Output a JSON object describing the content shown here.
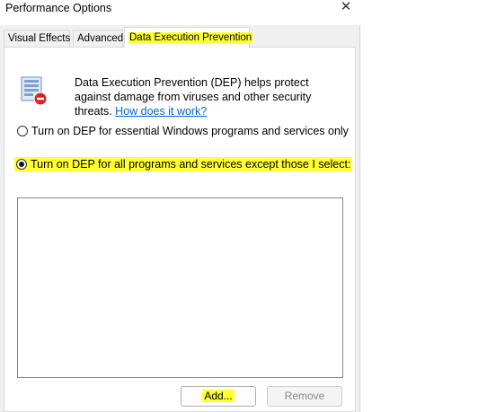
{
  "window": {
    "title": "Performance Options",
    "close_glyph": "✕"
  },
  "tabs": [
    {
      "label": "Visual Effects",
      "active": false
    },
    {
      "label": "Advanced",
      "active": false
    },
    {
      "label": "Data Execution Prevention",
      "active": true
    }
  ],
  "dep": {
    "icon": "dep-shield-icon",
    "description": "Data Execution Prevention (DEP) helps protect against damage from viruses and other security threats.",
    "link_text": "How does it work?"
  },
  "options": [
    {
      "label": "Turn on DEP for essential Windows programs and services only",
      "checked": false
    },
    {
      "label": "Turn on DEP for all programs and services except those I select:",
      "checked": true
    }
  ],
  "buttons": {
    "add": "Add...",
    "remove": "Remove"
  },
  "colors": {
    "highlight": "#ffff32",
    "link": "#0066cc"
  }
}
